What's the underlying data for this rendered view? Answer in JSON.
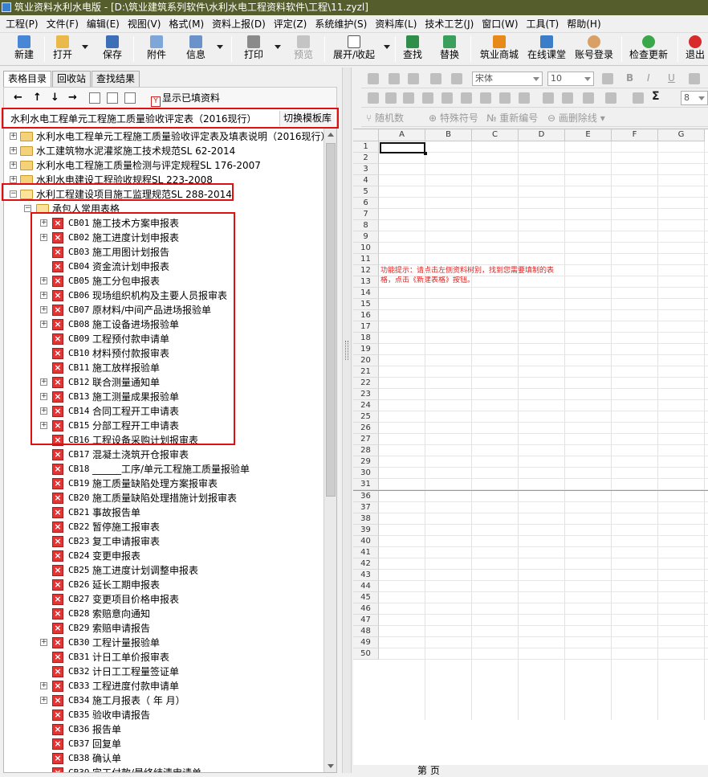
{
  "window": {
    "title": "筑业资料水利水电版 - [D:\\筑业建筑系列软件\\水利水电工程资料软件\\工程\\11.zyzl]"
  },
  "menu": [
    "工程(P)",
    "文件(F)",
    "编辑(E)",
    "视图(V)",
    "格式(M)",
    "资料上报(D)",
    "评定(Z)",
    "系统维护(S)",
    "资料库(L)",
    "技术工艺(J)",
    "窗口(W)",
    "工具(T)",
    "帮助(H)"
  ],
  "toolbar": {
    "new": "新建",
    "open": "打开",
    "save": "保存",
    "attach": "附件",
    "info": "信息",
    "print": "打印",
    "preview": "预览",
    "expand_collapse": "展开/收起",
    "find": "查找",
    "replace": "替换",
    "mall": "筑业商城",
    "online_class": "在线课堂",
    "login": "账号登录",
    "update": "检查更新",
    "exit": "退出"
  },
  "left": {
    "tabs": [
      "表格目录",
      "回收站",
      "查找结果"
    ],
    "show_filled": "显示已填资料",
    "template_selected": "水利水电工程单元工程施工质量验收评定表（2016现行）",
    "switch_template": "切换模板库"
  },
  "tree": {
    "top_items": [
      "水利水电工程单元工程施工质量验收评定表及填表说明（2016现行）",
      "水工建筑物水泥灌浆施工技术规范SL 62-2014",
      "水利水电工程施工质量检测与评定规程SL 176-2007",
      "水利水电建设工程验收规程SL 223-2008",
      "水利工程建设项目施工监理规范SL 288-2014"
    ],
    "group": "承包人常用表格",
    "forms": [
      {
        "code": "CB01",
        "name": "施工技术方案申报表"
      },
      {
        "code": "CB02",
        "name": "施工进度计划申报表"
      },
      {
        "code": "CB03",
        "name": "施工用图计划报告"
      },
      {
        "code": "CB04",
        "name": "资金流计划申报表"
      },
      {
        "code": "CB05",
        "name": "施工分包申报表"
      },
      {
        "code": "CB06",
        "name": "现场组织机构及主要人员报审表"
      },
      {
        "code": "CB07",
        "name": "原材料/中间产品进场报验单"
      },
      {
        "code": "CB08",
        "name": "施工设备进场报验单"
      },
      {
        "code": "CB09",
        "name": "工程预付款申请单"
      },
      {
        "code": "CB10",
        "name": "材料预付款报审表"
      },
      {
        "code": "CB11",
        "name": "施工放样报验单"
      },
      {
        "code": "CB12",
        "name": "联合测量通知单"
      },
      {
        "code": "CB13",
        "name": "施工测量成果报验单"
      },
      {
        "code": "CB14",
        "name": "合同工程开工申请表"
      },
      {
        "code": "CB15",
        "name": "分部工程开工申请表"
      },
      {
        "code": "CB16",
        "name": "工程设备采购计划报审表"
      },
      {
        "code": "CB17",
        "name": "混凝土浇筑开仓报审表"
      },
      {
        "code": "CB18",
        "name": "______工序/单元工程施工质量报验单"
      },
      {
        "code": "CB19",
        "name": "施工质量缺陷处理方案报审表"
      },
      {
        "code": "CB20",
        "name": "施工质量缺陷处理措施计划报审表"
      },
      {
        "code": "CB21",
        "name": "事故报告单"
      },
      {
        "code": "CB22",
        "name": "暂停施工报审表"
      },
      {
        "code": "CB23",
        "name": "复工申请报审表"
      },
      {
        "code": "CB24",
        "name": "变更申报表"
      },
      {
        "code": "CB25",
        "name": "施工进度计划调整申报表"
      },
      {
        "code": "CB26",
        "name": "延长工期申报表"
      },
      {
        "code": "CB27",
        "name": "变更项目价格申报表"
      },
      {
        "code": "CB28",
        "name": "索赔意向通知"
      },
      {
        "code": "CB29",
        "name": "索赔申请报告"
      },
      {
        "code": "CB30",
        "name": "工程计量报验单"
      },
      {
        "code": "CB31",
        "name": "计日工单价报审表"
      },
      {
        "code": "CB32",
        "name": "计日工工程量签证单"
      },
      {
        "code": "CB33",
        "name": "工程进度付款申请单"
      },
      {
        "code": "CB34",
        "name": "施工月报表（      年   月）"
      },
      {
        "code": "CB35",
        "name": "验收申请报告"
      },
      {
        "code": "CB36",
        "name": "报告单"
      },
      {
        "code": "CB37",
        "name": "回复单"
      },
      {
        "code": "CB38",
        "name": "确认单"
      },
      {
        "code": "CB39",
        "name": "完工付款/最终结清申请单"
      }
    ]
  },
  "editor": {
    "font": "宋体",
    "font_size": "10",
    "bold": "B",
    "italic": "I",
    "underline": "U",
    "sigma": "Σ",
    "zoom_partial": "8",
    "random_number": "随机数",
    "special_symbol": "特殊符号",
    "renumber": "重新编号",
    "delete_line": "画删除线",
    "columns": [
      "A",
      "B",
      "C",
      "D",
      "E",
      "F",
      "G"
    ],
    "rows_top": [
      "1",
      "2",
      "3",
      "4",
      "5",
      "6",
      "7",
      "8",
      "9",
      "10",
      "11",
      "12",
      "13",
      "14",
      "15",
      "16",
      "17",
      "18",
      "19",
      "20",
      "21",
      "22",
      "23",
      "24",
      "25",
      "26",
      "27",
      "28",
      "29",
      "30",
      "31"
    ],
    "rows_bottom": [
      "36",
      "37",
      "38",
      "39",
      "40",
      "41",
      "42",
      "43",
      "44",
      "45",
      "46",
      "47",
      "48",
      "49",
      "50"
    ],
    "hint": "功能提示：请点击左侧资料树别，找到您需要填制的表格，点击《新建表格》按钮。",
    "sheet_tab": "第 页"
  },
  "colors": {
    "titlebar": "#565d2c",
    "highlight": "#e01010",
    "form_icon": "#e43535"
  }
}
